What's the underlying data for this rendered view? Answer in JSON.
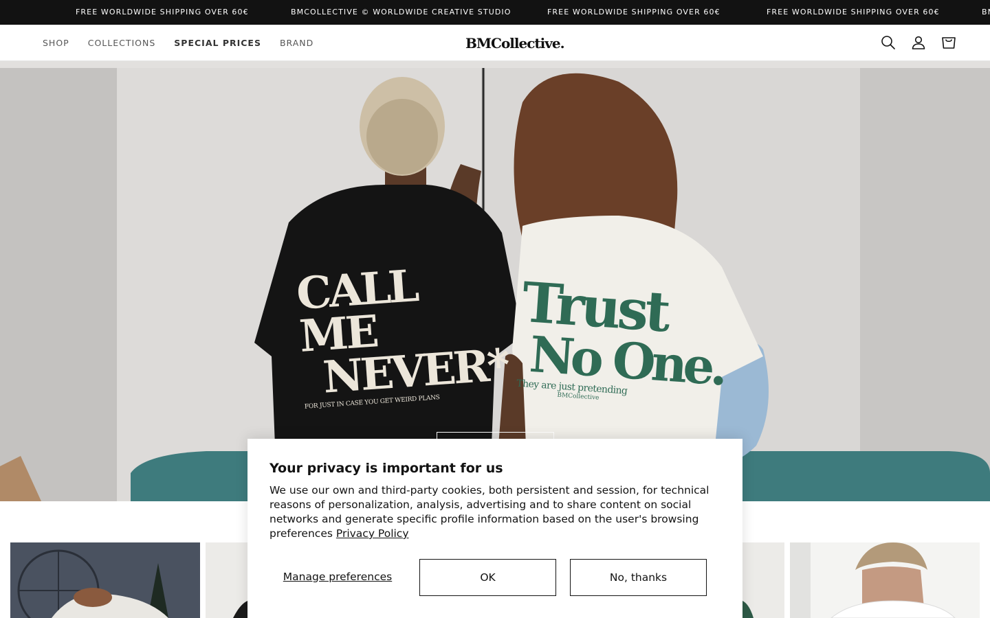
{
  "announcement": {
    "items": [
      "FREE WORLDWIDE SHIPPING OVER 60€",
      "BMCOLLECTIVE © WORLDWIDE CREATIVE STUDIO",
      "FREE WORLDWIDE SHIPPING OVER 60€",
      "FREE WORLDWIDE SHIPPING OVER 60€",
      "BM"
    ]
  },
  "header": {
    "nav": [
      {
        "label": "SHOP"
      },
      {
        "label": "COLLECTIONS"
      },
      {
        "label": "SPECIAL PRICES"
      },
      {
        "label": "BRAND"
      }
    ],
    "logo_text": "BMCollective.",
    "icons": [
      "search-icon",
      "account-icon",
      "cart-icon"
    ]
  },
  "hero": {
    "left_shirt_text": {
      "line1": "CALL ME",
      "line2": "NEVER*",
      "line3": "FOR JUST IN CASE YOU GET WEIRD PLANS"
    },
    "right_shirt_text": {
      "line1": "Trust",
      "line2": "No One.",
      "line3": "They are just pretending",
      "line4": "BMCollective"
    }
  },
  "cookie": {
    "title": "Your privacy is important for us",
    "body": "We use our own and third-party cookies, both persistent and session, for technical reasons of personalization, analysis, advertising and to share content on social networks and generate specific profile information based on the user's browsing preferences",
    "policy_link": "Privacy Policy",
    "manage_label": "Manage preferences",
    "ok_label": "OK",
    "no_label": "No, thanks"
  },
  "colors": {
    "announcement_bg": "#121212",
    "shirt_dark": "#141414",
    "shirt_light": "#f1efe9",
    "print_green": "#2f6b55",
    "sofa": "#3e7b7d"
  }
}
